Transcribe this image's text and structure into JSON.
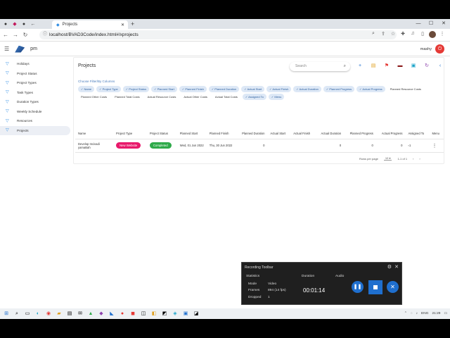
{
  "browser": {
    "tab_title": "Projects",
    "url": "localhost/BVAD3Code/index.html#/xprojects",
    "new_tab": "+"
  },
  "app": {
    "name": "pm",
    "user": "mashy"
  },
  "sidebar": {
    "items": [
      {
        "label": "Holidays"
      },
      {
        "label": "Project Status"
      },
      {
        "label": "Project Types"
      },
      {
        "label": "Task Types"
      },
      {
        "label": "Duration Types"
      },
      {
        "label": "Weekly Schedule"
      },
      {
        "label": "Resources"
      },
      {
        "label": "Projects"
      }
    ],
    "active_index": 7
  },
  "main": {
    "title": "Projects",
    "search_placeholder": "Search",
    "choose_label": "Choose Filter/By Columns",
    "filter_chips": [
      {
        "label": "Name",
        "on": true
      },
      {
        "label": "Project Type",
        "on": true
      },
      {
        "label": "Project Status",
        "on": true
      },
      {
        "label": "Planned Start",
        "on": true
      },
      {
        "label": "Planned Finish",
        "on": true
      },
      {
        "label": "Planned Duration",
        "on": true
      },
      {
        "label": "Actual Start",
        "on": true
      },
      {
        "label": "Actual Finish",
        "on": true
      },
      {
        "label": "Actual Duration",
        "on": true
      },
      {
        "label": "Planned Progress",
        "on": true
      },
      {
        "label": "Actual Progress",
        "on": true
      },
      {
        "label": "Planned Resource Costs",
        "on": false
      },
      {
        "label": "Planned Other Costs",
        "on": false
      },
      {
        "label": "Planned Total Costs",
        "on": false
      },
      {
        "label": "Actual Resource Costs",
        "on": false
      },
      {
        "label": "Actual Other Costs",
        "on": false
      },
      {
        "label": "Actual Total Costs",
        "on": false
      },
      {
        "label": "Assigned To",
        "on": true
      },
      {
        "label": "Menu",
        "on": true
      }
    ],
    "table": {
      "headers": [
        "Name",
        "Project Type",
        "Project Status",
        "Planned Start",
        "Planned Finish",
        "Planned Duration",
        "Actual Start",
        "Actual Finish",
        "Actual Duration",
        "Planned Progress",
        "Actual Progress",
        "Assigned To",
        "Menu"
      ],
      "row": {
        "name": "Develop Incivadi yamaBah",
        "project_type": "New Website",
        "project_status": "Completed",
        "planned_start": "Wed, 01 Jun 2022",
        "planned_finish": "Thu, 30 Jun 2022",
        "planned_duration": "0",
        "actual_start": "",
        "actual_finish": "",
        "actual_duration": "0",
        "planned_progress": "0",
        "actual_progress": "0",
        "assigned_to": "1",
        "menu": "⋮"
      }
    },
    "pager": {
      "rows_label": "Rows per page",
      "rows_value": "10",
      "range": "1-1 of 1"
    }
  },
  "recording": {
    "title": "Recording Toolbar",
    "statistics_label": "Statistics",
    "duration_label": "Duration",
    "audio_label": "Audio",
    "mode_label": "Mode",
    "mode_value": "Video",
    "frames_label": "Frames",
    "frames_value": "894 (14 fps)",
    "dropped_label": "Dropped",
    "dropped_value": "1",
    "duration_value": "00:01:14"
  },
  "taskbar": {
    "lang": "ENG",
    "time": "21:29"
  },
  "colors": {
    "accent": "#1f6fce",
    "pink": "#e8196b",
    "green": "#2faa4a",
    "power": "#e53935"
  }
}
